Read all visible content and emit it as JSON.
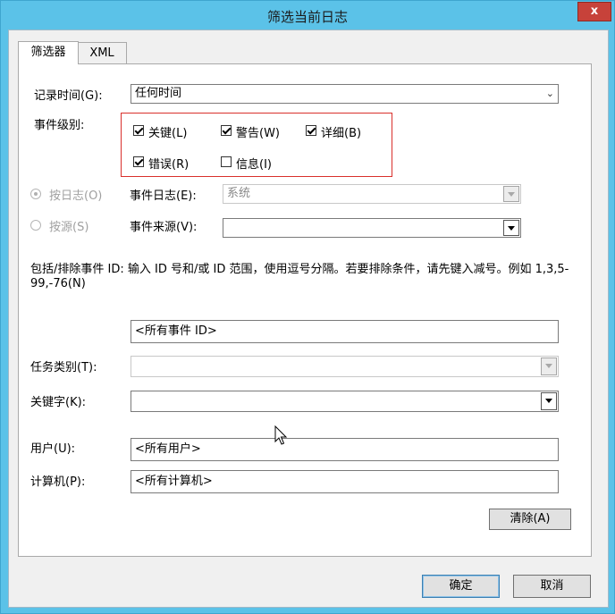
{
  "window": {
    "title": "筛选当前日志",
    "close_label": "x"
  },
  "tabs": [
    {
      "label": "筛选器",
      "active": true
    },
    {
      "label": "XML",
      "active": false
    }
  ],
  "logged": {
    "label": "记录时间(G):",
    "value": "任何时间"
  },
  "event_level": {
    "label": "事件级别:",
    "options": [
      {
        "label": "关键(L)",
        "checked": true
      },
      {
        "label": "警告(W)",
        "checked": true
      },
      {
        "label": "详细(B)",
        "checked": true
      },
      {
        "label": "错误(R)",
        "checked": true
      },
      {
        "label": "信息(I)",
        "checked": false
      }
    ]
  },
  "by_log": {
    "label": "按日志(O)",
    "selected": true,
    "field_label": "事件日志(E):",
    "value": "系统"
  },
  "by_source": {
    "label": "按源(S)",
    "selected": false,
    "field_label": "事件来源(V):",
    "value": ""
  },
  "event_ids": {
    "description": "包括/排除事件 ID: 输入 ID 号和/或 ID 范围，使用逗号分隔。若要排除条件，请先键入减号。例如 1,3,5-99,-76(N)",
    "value": "<所有事件 ID>"
  },
  "task_category": {
    "label": "任务类别(T):",
    "value": ""
  },
  "keywords": {
    "label": "关键字(K):",
    "value": ""
  },
  "user": {
    "label": "用户(U):",
    "value": "<所有用户>"
  },
  "computer": {
    "label": "计算机(P):",
    "value": "<所有计算机>"
  },
  "buttons": {
    "clear": "清除(A)",
    "ok": "确定",
    "cancel": "取消"
  }
}
